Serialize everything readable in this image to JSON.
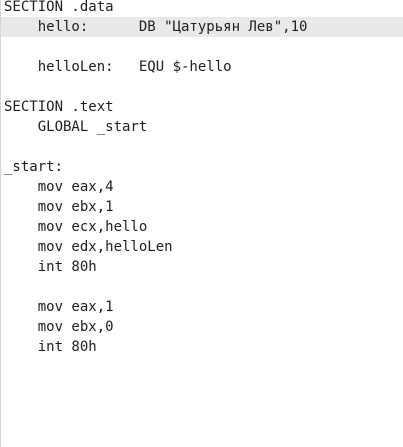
{
  "editor": {
    "lines": [
      "SECTION .data",
      "    hello:      DB \"Цатурьян Лев\",10",
      "",
      "    helloLen:   EQU $-hello",
      "",
      "SECTION .text",
      "    GLOBAL _start",
      "",
      "_start:",
      "    mov eax,4",
      "    mov ebx,1",
      "    mov ecx,hello",
      "    mov edx,helloLen",
      "    int 80h",
      "",
      "    mov eax,1",
      "    mov ebx,0",
      "    int 80h"
    ],
    "current_line": 2
  },
  "colors": {
    "background": "#ffffff",
    "text": "#1e1e1e",
    "current_line_highlight": "#e9e9e9"
  }
}
